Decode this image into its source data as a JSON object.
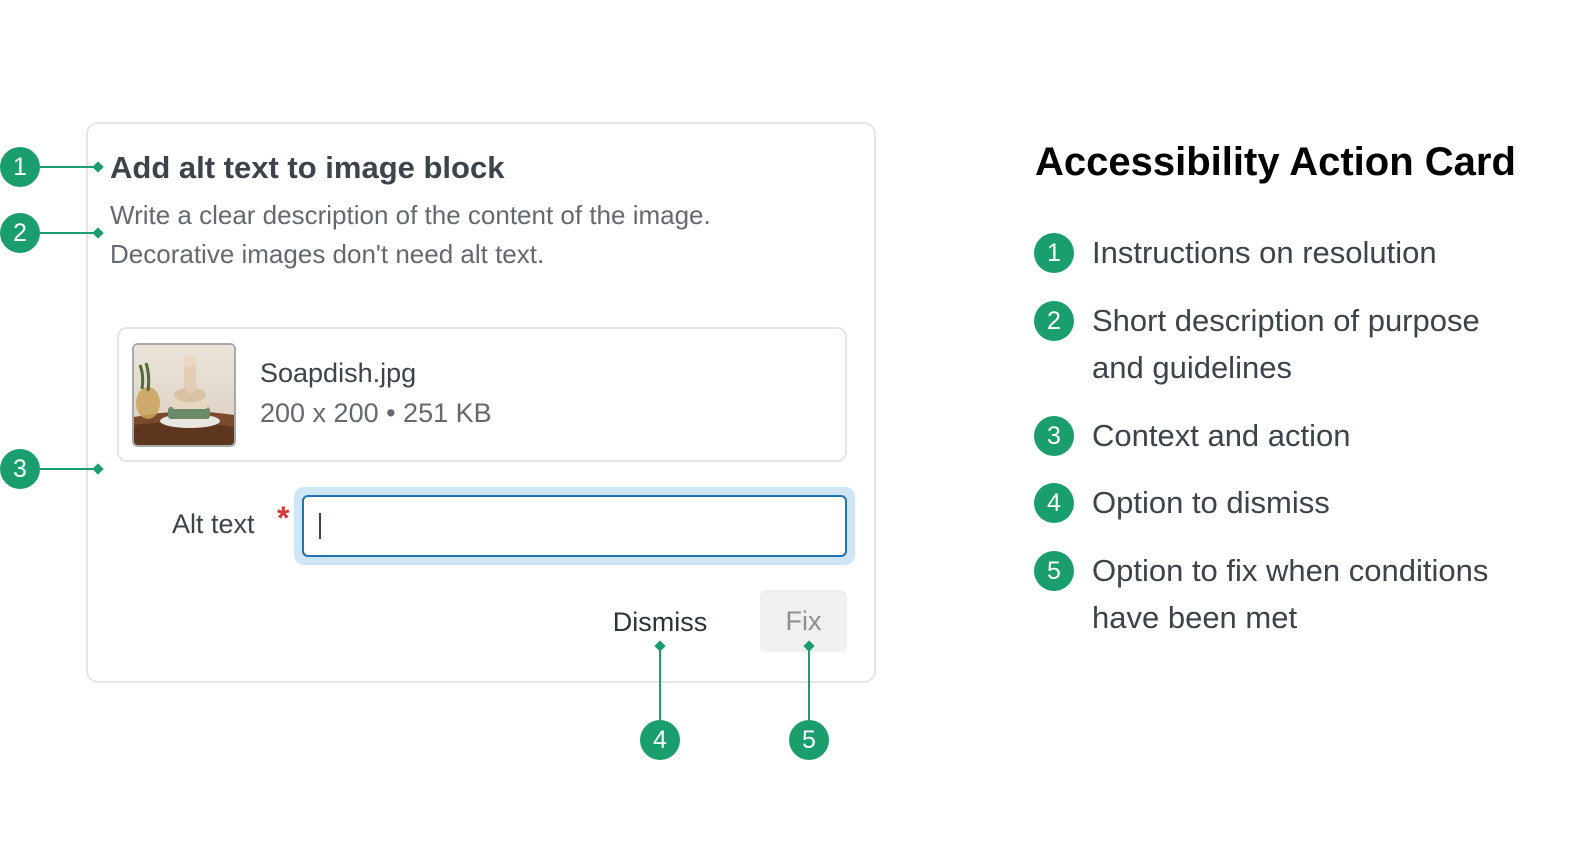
{
  "card": {
    "title": "Add alt text to image block",
    "description_lines": [
      "Write a clear description of the content of the image.",
      "Decorative images don't need alt text."
    ],
    "file": {
      "name": "Soapdish.jpg",
      "meta": "200 x 200 • 251 KB"
    },
    "alt_text": {
      "label": "Alt text",
      "required_marker": "*",
      "value": ""
    },
    "buttons": {
      "dismiss": "Dismiss",
      "fix": "Fix"
    }
  },
  "callouts": [
    "1",
    "2",
    "3",
    "4",
    "5"
  ],
  "legend": {
    "title": "Accessibility Action Card",
    "items": [
      {
        "number": "1",
        "lines": [
          "Instructions on resolution"
        ]
      },
      {
        "number": "2",
        "lines": [
          "Short description of purpose",
          "and guidelines"
        ]
      },
      {
        "number": "3",
        "lines": [
          "Context and action"
        ]
      },
      {
        "number": "4",
        "lines": [
          "Option to dismiss"
        ]
      },
      {
        "number": "5",
        "lines": [
          "Option to fix when conditions",
          "have been met"
        ]
      }
    ]
  },
  "colors": {
    "accent_green": "#1a9e6e",
    "focus_blue": "#2271b1",
    "required_red": "#d63638"
  }
}
